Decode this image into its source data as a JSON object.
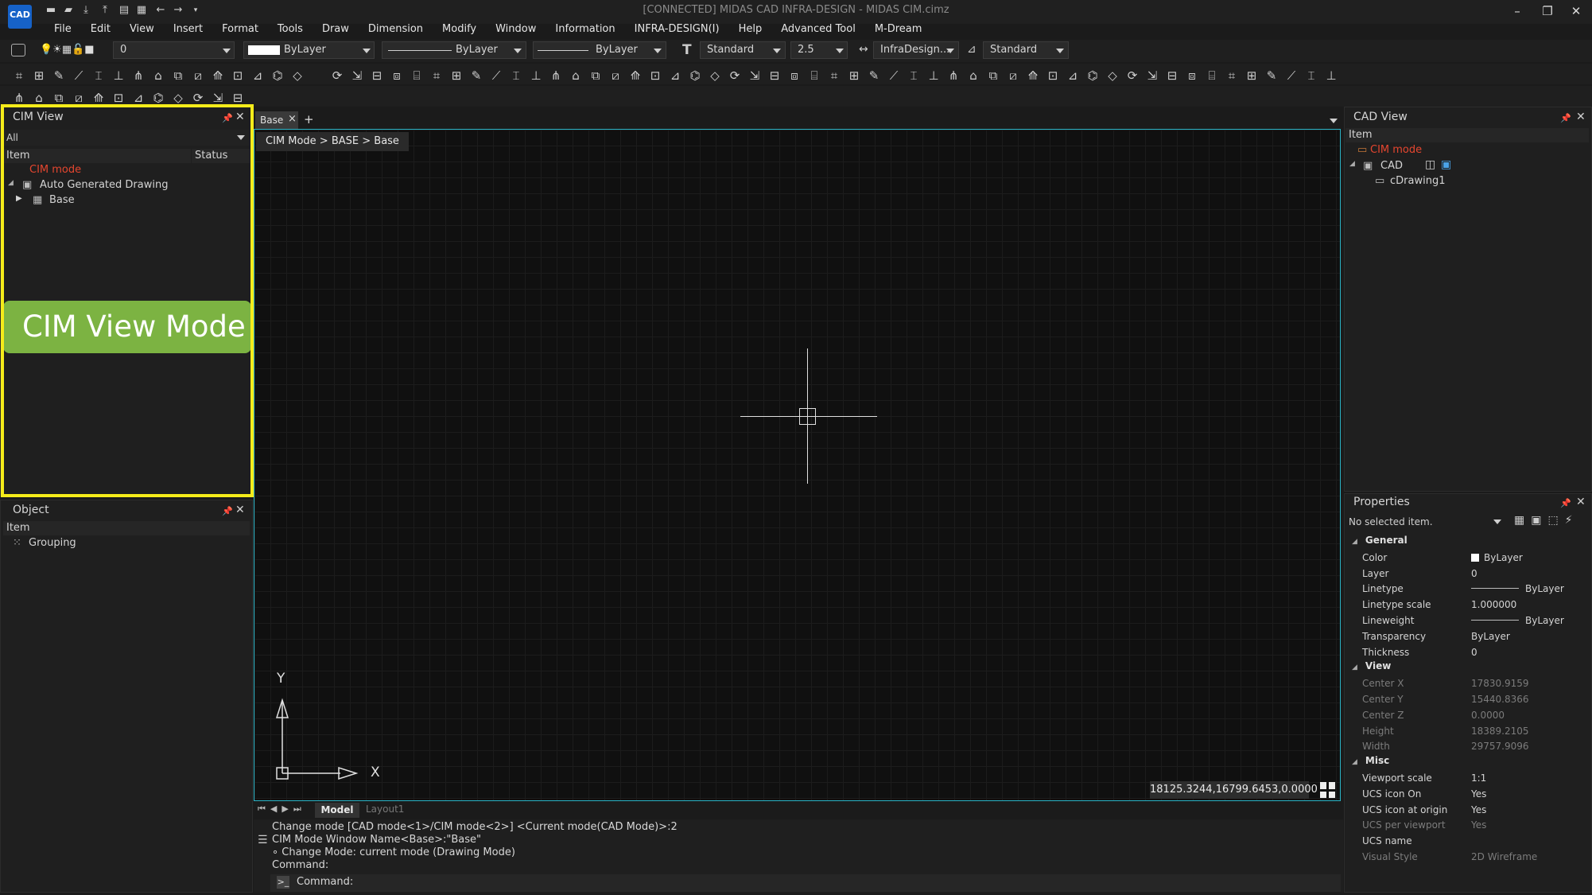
{
  "app": {
    "logo_text": "CAD",
    "title": "[CONNECTED] MIDAS CAD INFRA-DESIGN - MIDAS CIM.cimz",
    "quick_access_icons": [
      "new-file-icon",
      "open-folder-icon",
      "import-icon",
      "export-icon",
      "print-icon",
      "print-preview-icon",
      "undo-icon",
      "redo-icon",
      "customize-quick-access-icon"
    ],
    "window_controls": {
      "minimize": "–",
      "restore": "❐",
      "close": "✕"
    }
  },
  "menu": [
    "File",
    "Edit",
    "View",
    "Insert",
    "Format",
    "Tools",
    "Draw",
    "Dimension",
    "Modify",
    "Window",
    "Information",
    "INFRA-DESIGN(I)",
    "Help",
    "Advanced Tool",
    "M-Dream"
  ],
  "toolbar": {
    "layer_value": "0",
    "color_value": "ByLayer",
    "linetype_value": "ByLayer",
    "lineweight_value": "ByLayer",
    "text_style_value": "Standard",
    "text_height_value": "2.5",
    "dim_style_value": "InfraDesign...",
    "table_style_value": "Standard"
  },
  "cim_view": {
    "title": "CIM View",
    "filter": "All",
    "col_item": "Item",
    "col_status": "Status",
    "tree": [
      {
        "label": "CIM mode",
        "color": "#e5462f"
      },
      {
        "label": "Auto Generated Drawing"
      },
      {
        "label": "Base"
      }
    ],
    "mode_badge": "CIM View Mode",
    "highlight_color": "#f5ec1a",
    "badge_color": "#7cb342"
  },
  "object_panel": {
    "title": "Object",
    "col_item": "Item",
    "items": [
      "Grouping"
    ]
  },
  "viewport": {
    "tab_label": "Base",
    "tab_close": "×",
    "tab_add": "+",
    "breadcrumb": "CIM Mode > BASE > Base",
    "coordinates": "18125.3244,16799.6453,0.0000",
    "axis_x": "X",
    "axis_y": "Y",
    "border_color": "#2ab3c6",
    "layout_tabs": [
      "Model",
      "Layout1"
    ]
  },
  "command": {
    "lines": [
      "Change mode [CAD mode<1>/CIM mode<2>] <Current mode(CAD Mode)>:2",
      "CIM Mode Window Name<Base>:\"Base\"",
      " ∘ Change Mode: current mode (Drawing Mode)",
      "Command:"
    ],
    "prompt": "Command:"
  },
  "cad_view": {
    "title": "CAD View",
    "col_item": "Item",
    "tree": [
      {
        "label": "CIM mode",
        "color": "#e5462f"
      },
      {
        "label": "CAD"
      },
      {
        "label": "cDrawing1"
      }
    ]
  },
  "properties": {
    "title": "Properties",
    "selection": "No selected item.",
    "sections": [
      {
        "name": "General",
        "rows": [
          [
            "Color",
            "ByLayer"
          ],
          [
            "Layer",
            "0"
          ],
          [
            "Linetype",
            "ByLayer"
          ],
          [
            "Linetype scale",
            "1.000000"
          ],
          [
            "Lineweight",
            "ByLayer"
          ],
          [
            "Transparency",
            "ByLayer"
          ],
          [
            "Thickness",
            "0"
          ]
        ]
      },
      {
        "name": "View",
        "rows": [
          [
            "Center X",
            "17830.9159"
          ],
          [
            "Center Y",
            "15440.8366"
          ],
          [
            "Center Z",
            "0.0000"
          ],
          [
            "Height",
            "18389.2105"
          ],
          [
            "Width",
            "29757.9096"
          ]
        ]
      },
      {
        "name": "Misc",
        "rows": [
          [
            "Viewport scale",
            "1:1"
          ],
          [
            "UCS icon On",
            "Yes"
          ],
          [
            "UCS icon at origin",
            "Yes"
          ],
          [
            "UCS per viewport",
            "Yes"
          ],
          [
            "UCS name",
            ""
          ],
          [
            "Visual Style",
            "2D Wireframe"
          ]
        ]
      }
    ]
  }
}
